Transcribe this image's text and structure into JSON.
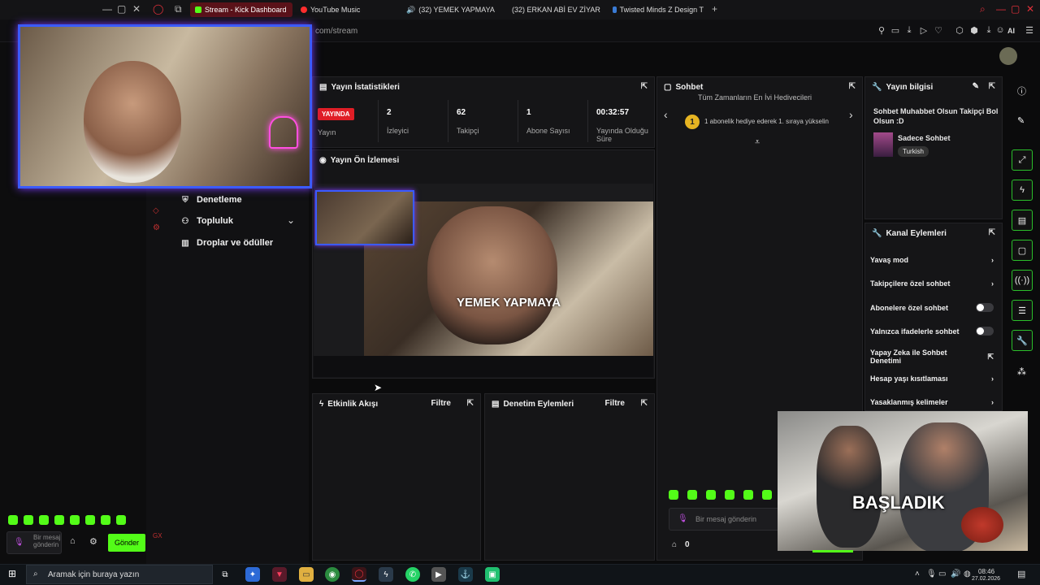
{
  "browser": {
    "tabs": [
      {
        "label": "Stream - Kick Dashboard",
        "active": true,
        "color": "#53fc18"
      },
      {
        "label": "YouTube Music",
        "active": false,
        "color": "#ff2d2d"
      },
      {
        "label": "(32) YEMEK YAPMAYA",
        "active": false,
        "color": "#ff2d2d"
      },
      {
        "label": "(32) ERKAN ABİ EV ZİYAR",
        "active": false,
        "color": "#ff2d2d"
      },
      {
        "label": "Twisted Minds Z Design T",
        "active": false,
        "color": "#3a7bd5"
      }
    ],
    "new_tab": "+",
    "url": "com/stream",
    "ai_label": "AI"
  },
  "nav": {
    "items": [
      {
        "label": "Denetleme",
        "icon": "shield-icon"
      },
      {
        "label": "Topluluk",
        "icon": "people-icon"
      },
      {
        "label": "Droplar ve ödüller",
        "icon": "gift-icon"
      }
    ]
  },
  "stats": {
    "title": "Yayın İstatistikleri",
    "live_badge": "YAYINDA",
    "items": [
      {
        "value": "2",
        "label": "İzleyici"
      },
      {
        "value": "62",
        "label": "Takipçi"
      },
      {
        "value": "1",
        "label": "Abone Sayısı"
      },
      {
        "value": "00:32:57",
        "label": "Yayında Olduğu Süre"
      }
    ],
    "live_label": "Yayın"
  },
  "preview": {
    "title": "Yayın Ön İzlemesi",
    "overlay_text": "YEMEK YAPMAYA"
  },
  "activity": {
    "title": "Etkinlik Akışı",
    "filter": "Filtre"
  },
  "moderation": {
    "title": "Denetim Eylemleri",
    "filter": "Filtre"
  },
  "chat": {
    "title": "Sohbet",
    "top_line": "Tüm Zamanların En İyi Hediyecileri",
    "rank": "1",
    "gift_text": "1 abonelik hediye ederek 1. sıraya yükselin",
    "input_placeholder": "Bir mesaj gönderin",
    "points": "0"
  },
  "stream_info": {
    "title": "Yayın bilgisi",
    "stream_title": "Sohbet Muhabbet Olsun Takipçi Bol Olsun :D",
    "category": "Sadece Sohbet",
    "language": "Turkish"
  },
  "channel_actions": {
    "title": "Kanal Eylemleri",
    "items": [
      {
        "label": "Yavaş mod",
        "control": "chevron"
      },
      {
        "label": "Takipçilere özel sohbet",
        "control": "chevron"
      },
      {
        "label": "Abonelere özel sohbet",
        "control": "toggle"
      },
      {
        "label": "Yalnızca ifadelerle sohbet",
        "control": "toggle"
      },
      {
        "label": "Yapay Zeka ile Sohbet Denetimi",
        "control": "external"
      },
      {
        "label": "Hesap yaşı kısıtlaması",
        "control": "chevron"
      },
      {
        "label": "Yasaklanmış kelimeler",
        "control": "chevron"
      }
    ]
  },
  "overlay_chat": {
    "placeholder": "Bir mesaj gönderin",
    "send": "Gönder"
  },
  "pip_video": {
    "caption": "BAŞLADIK"
  },
  "taskbar": {
    "search": "Aramak için buraya yazın",
    "time": "08:46",
    "date": "27.02.2026"
  },
  "colors": {
    "accent": "#53fc18",
    "live": "#e01e26",
    "webcam_border": "#3b5bff"
  }
}
